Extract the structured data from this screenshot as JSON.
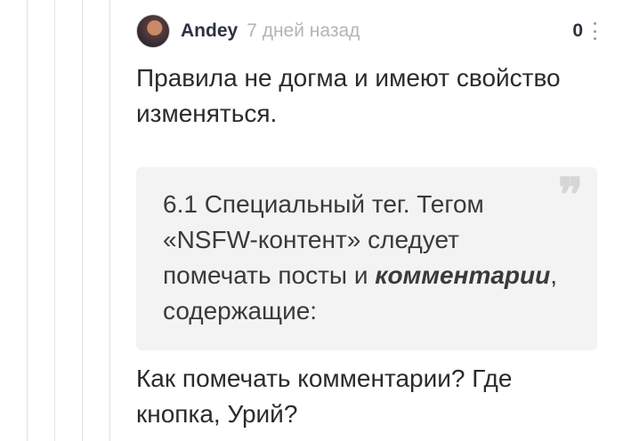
{
  "comment": {
    "author": "Andey",
    "timestamp": "7 дней назад",
    "rating": "0",
    "icons": {
      "avatar": "user-avatar",
      "menu": "vertical-dots-icon",
      "quote": "quote-marks-icon"
    },
    "text_1": "Правила не догма и имеют свойство изменяться.",
    "quote": {
      "before": "6.1 Специальный тег. Тегом «NSFW-контент» следует помечать посты и ",
      "emphasis": "комментарии",
      "after": ", содержащие:",
      "mark": "❞"
    },
    "text_2": "Как помечать комментарии? Где кнопка, Урий?"
  },
  "colors": {
    "author": "#2d3240",
    "timestamp": "#b4b4b4",
    "quote_background": "#f3f3f3",
    "thread_line": "#e3e3e3"
  }
}
